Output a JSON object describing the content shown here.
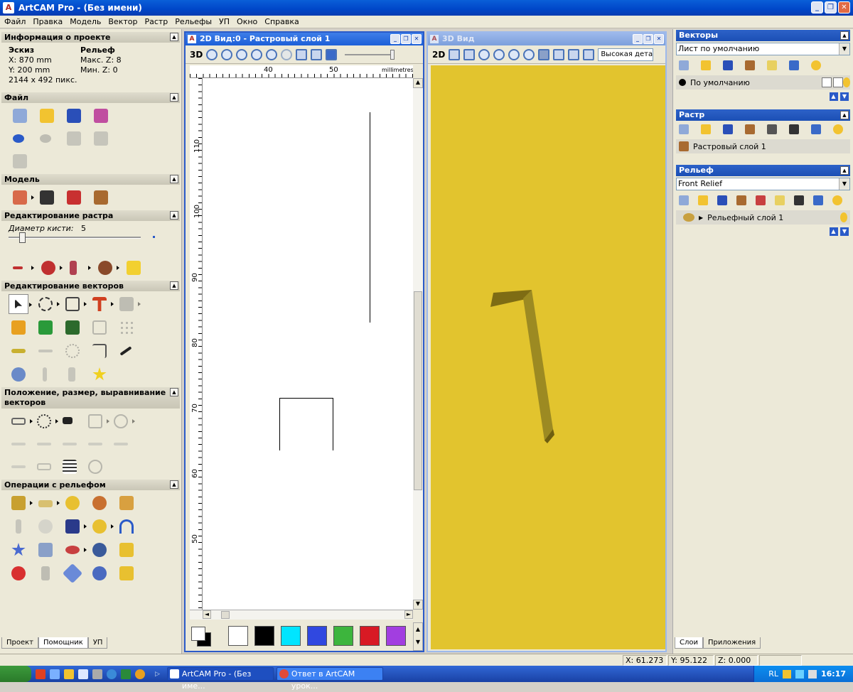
{
  "window": {
    "title": "ArtCAM Pro - (Без имени)",
    "min": "_",
    "max": "❐",
    "close": "✕"
  },
  "menu": [
    "Файл",
    "Правка",
    "Модель",
    "Вектор",
    "Растр",
    "Рельефы",
    "УП",
    "Окно",
    "Справка"
  ],
  "left": {
    "project_info": {
      "header": "Информация о проекте",
      "sketch_label": "Эскиз",
      "x": "X: 870 mm",
      "y": "Y: 200 mm",
      "pixels": "2144 x 492 пикс.",
      "relief_label": "Рельеф",
      "max_z": "Макс. Z: 8",
      "min_z": "Мин. Z: 0"
    },
    "file_header": "Файл",
    "model_header": "Модель",
    "raster_edit_header": "Редактирование растра",
    "brush_label": "Диаметр кисти:",
    "brush_value": "5",
    "brush_level": 0.08,
    "vector_edit_header": "Редактирование векторов",
    "position_header": "Положение, размер, выравнивание векторов",
    "relief_ops_header": "Операции с рельефом",
    "tabs": [
      "Проект",
      "Помощник",
      "УП"
    ]
  },
  "view2d": {
    "title": "2D Вид:0 - Растровый слой 1",
    "toolbar_3d": "3D",
    "ruler_units": "millimetres",
    "ruler_top": [
      "40",
      "50"
    ],
    "ruler_left": [
      "110",
      "100",
      "90",
      "80",
      "70",
      "60",
      "50"
    ]
  },
  "view3d": {
    "title": "3D Вид",
    "toolbar_2d": "2D",
    "quality_select": "Высокая детал"
  },
  "right": {
    "vectors": {
      "header": "Векторы",
      "sheet": "Лист по умолчанию",
      "layer": "По умолчанию"
    },
    "raster": {
      "header": "Растр",
      "layer": "Растровый слой 1"
    },
    "relief": {
      "header": "Рельеф",
      "select": "Front Relief",
      "layer": "Рельефный слой 1"
    },
    "tabs": [
      "Слои",
      "Приложения"
    ]
  },
  "status": {
    "x": "X: 61.273",
    "y": "Y: 95.122",
    "z": "Z: 0.000"
  },
  "taskbar": {
    "tasks": [
      "ArtCAM Pro - (Без име...",
      "Ответ в ArtCAM урок..."
    ],
    "lang": "RL",
    "time": "16:17"
  },
  "colors": {
    "accent": "#0a5fd8",
    "viewport3d": "#e2c42e",
    "relief_shape": "#8c7a1c"
  },
  "palette": [
    "#ffffff",
    "#000000",
    "#00e5ff",
    "#3048e0",
    "#3db53d",
    "#d81a24",
    "#a23ee0"
  ]
}
